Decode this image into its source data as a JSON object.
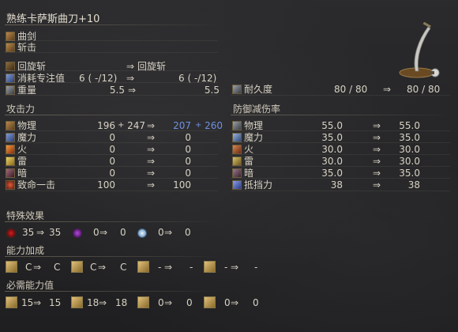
{
  "weapon": {
    "name": "熟练卡萨斯曲刀+10",
    "type": "曲剑",
    "attack_type": "斩击",
    "skill_current": "回旋斩",
    "skill_arrow": "⇒",
    "skill_new": "回旋斩",
    "fp_label": "消耗专注值",
    "fp_current": "6 (  -/12)",
    "fp_arrow": "⇒",
    "fp_new": "6 (  -/12)",
    "weight_label": "重量",
    "weight_current": "5.5",
    "weight_arrow": "⇒",
    "weight_new": "5.5",
    "durability_label": "耐久度",
    "durability_current": "80 /   80",
    "durability_arrow": "⇒",
    "durability_new": "80 /   80"
  },
  "attack": {
    "header": "攻击力",
    "rows": [
      {
        "label": "物理",
        "a": "196",
        "plus": "+",
        "b": "247",
        "arrow": "⇒",
        "c": "207",
        "plus2": "+",
        "d": "260"
      },
      {
        "label": "魔力",
        "a": "0",
        "arrow": "⇒",
        "c": "0"
      },
      {
        "label": "火",
        "a": "0",
        "arrow": "⇒",
        "c": "0"
      },
      {
        "label": "雷",
        "a": "0",
        "arrow": "⇒",
        "c": "0"
      },
      {
        "label": "暗",
        "a": "0",
        "arrow": "⇒",
        "c": "0"
      },
      {
        "label": "致命一击",
        "a": "100",
        "arrow": "⇒",
        "c": "100"
      }
    ]
  },
  "defense": {
    "header": "防御减伤率",
    "rows": [
      {
        "label": "物理",
        "a": "55.0",
        "arrow": "⇒",
        "b": "55.0"
      },
      {
        "label": "魔力",
        "a": "35.0",
        "arrow": "⇒",
        "b": "35.0"
      },
      {
        "label": "火",
        "a": "30.0",
        "arrow": "⇒",
        "b": "30.0"
      },
      {
        "label": "雷",
        "a": "30.0",
        "arrow": "⇒",
        "b": "30.0"
      },
      {
        "label": "暗",
        "a": "35.0",
        "arrow": "⇒",
        "b": "35.0"
      },
      {
        "label": "抵挡力",
        "a": "38",
        "arrow": "⇒",
        "b": "38"
      }
    ]
  },
  "effects": {
    "header": "特殊效果",
    "items": [
      {
        "icon": "bleed-icon",
        "a": "35",
        "arrow": "⇒",
        "b": "35"
      },
      {
        "icon": "poison-icon",
        "a": "0",
        "arrow": "⇒",
        "b": "0"
      },
      {
        "icon": "frost-icon",
        "a": "0",
        "arrow": "⇒",
        "b": "0"
      }
    ]
  },
  "scaling": {
    "header": "能力加成",
    "items": [
      {
        "icon": "strength-icon",
        "a": "C",
        "arrow": "⇒",
        "b": "C"
      },
      {
        "icon": "dexterity-icon",
        "a": "C",
        "arrow": "⇒",
        "b": "C"
      },
      {
        "icon": "intelligence-icon",
        "a": "-",
        "arrow": "⇒",
        "b": "-"
      },
      {
        "icon": "faith-icon",
        "a": "-",
        "arrow": "⇒",
        "b": "-"
      }
    ]
  },
  "requirements": {
    "header": "必需能力值",
    "items": [
      {
        "icon": "strength-icon",
        "a": "15",
        "arrow": "⇒",
        "b": "15"
      },
      {
        "icon": "dexterity-icon",
        "a": "18",
        "arrow": "⇒",
        "b": "18"
      },
      {
        "icon": "intelligence-icon",
        "a": "0",
        "arrow": "⇒",
        "b": "0"
      },
      {
        "icon": "faith-icon",
        "a": "0",
        "arrow": "⇒",
        "b": "0"
      }
    ]
  }
}
